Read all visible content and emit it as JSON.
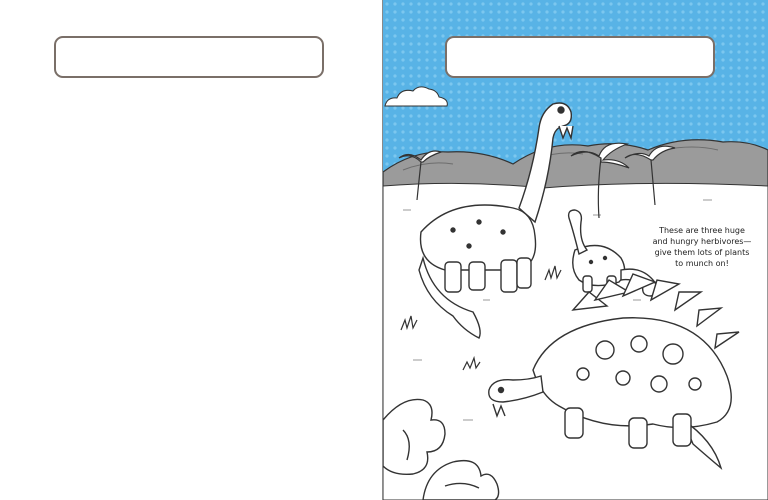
{
  "book_spread": {
    "left_page": {
      "title_box_text": ""
    },
    "right_page": {
      "title_box_text": "",
      "caption_lines": [
        "These are three huge",
        "and hungry herbivores—",
        "give them lots of plants",
        "to munch on!"
      ]
    }
  },
  "colors": {
    "sky_blue": "#58b3e6",
    "sky_dot": "#7cc7ef",
    "mountain_gray": "#9b9b9b",
    "line_art": "#333333",
    "box_border": "#7a6f68"
  }
}
